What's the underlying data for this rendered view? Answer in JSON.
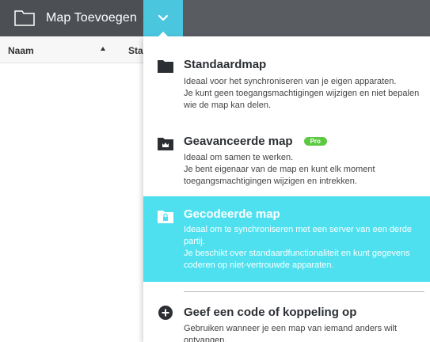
{
  "toolbar": {
    "add_folder_label": "Map Toevoegen",
    "dropdown_icon": "chevron-down-icon",
    "accent_color": "#4bc6df"
  },
  "list": {
    "columns": [
      "Naam",
      "Sta"
    ],
    "sort": "ascending"
  },
  "menu": {
    "items": [
      {
        "icon": "folder-icon",
        "title": "Standaardmap",
        "description": "Ideaal voor het synchroniseren van je eigen apparaten.\nJe kunt geen toegangsmachtigingen wijzigen en niet bepalen wie de map kan delen."
      },
      {
        "icon": "crown-folder-icon",
        "title": "Geavanceerde map",
        "badge": "Pro",
        "description": "Ideaal om samen te werken.\nJe bent eigenaar van de map en kunt elk moment toegangsmachtigingen wijzigen en intrekken."
      },
      {
        "icon": "lock-folder-icon",
        "title": "Gecodeerde map",
        "description": "Ideaal om te synchroniseren met een server van een derde partij.\nJe beschikt over standaardfunctionaliteit en kunt gegevens coderen op niet-vertrouwde apparaten.",
        "highlighted": true
      },
      {
        "icon": "plus-circle-icon",
        "title": "Geef een code of koppeling op",
        "description": "Gebruiken wanneer je een map van iemand anders wilt ontvangen."
      }
    ],
    "highlight_color": "#4ee0ef",
    "badge_color": "#5cc943"
  }
}
